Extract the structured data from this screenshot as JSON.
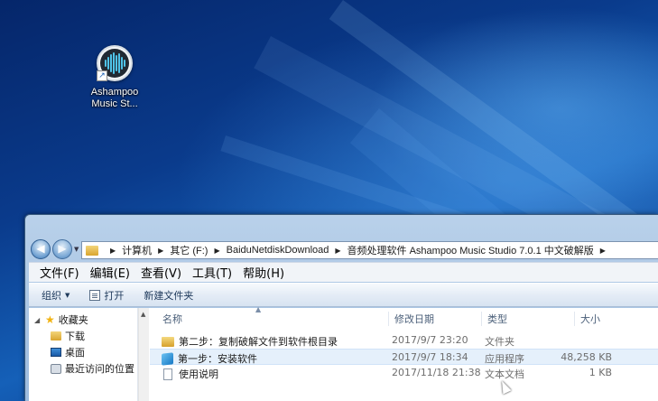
{
  "desktop": {
    "icon_label_line1": "Ashampoo",
    "icon_label_line2": "Music St..."
  },
  "explorer": {
    "breadcrumb": [
      "计算机",
      "其它 (F:)",
      "BaiduNetdiskDownload",
      "音频处理软件 Ashampoo Music Studio 7.0.1 中文破解版"
    ],
    "menu": [
      "文件(F)",
      "编辑(E)",
      "查看(V)",
      "工具(T)",
      "帮助(H)"
    ],
    "toolbar": {
      "organize": "组织",
      "open": "打开",
      "new_folder": "新建文件夹"
    },
    "nav_pane": {
      "favorites": "收藏夹",
      "downloads": "下载",
      "desktop": "桌面",
      "recent": "最近访问的位置"
    },
    "columns": {
      "name": "名称",
      "date": "修改日期",
      "type": "类型",
      "size": "大小"
    },
    "files": [
      {
        "name": "第二步：复制破解文件到软件根目录",
        "date": "2017/9/7 23:20",
        "type": "文件夹",
        "size": "",
        "icon": "folder-icon"
      },
      {
        "name": "第一步：安装软件",
        "date": "2017/9/7 18:34",
        "type": "应用程序",
        "size": "48,258 KB",
        "icon": "installer-icon"
      },
      {
        "name": "使用说明",
        "date": "2017/11/18 21:38",
        "type": "文本文档",
        "size": "1 KB",
        "icon": "text-file-icon"
      }
    ]
  }
}
